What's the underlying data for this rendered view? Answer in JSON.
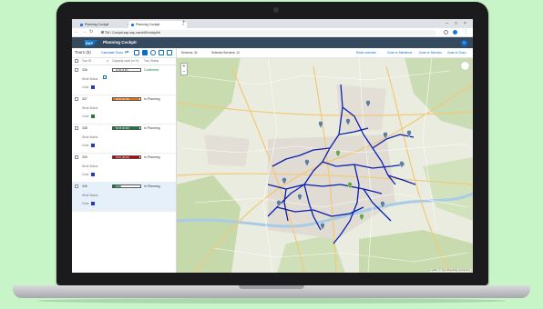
{
  "browser": {
    "tabs": [
      {
        "label": "Planning Cockpit"
      },
      {
        "label": "Planning Cockpit"
      }
    ],
    "url": "TM / Cockpit.sap.sap.com/ui5/cockpit/#"
  },
  "shell": {
    "logo": "SAP",
    "title": "Planning Cockpit",
    "avatar_initial": "U"
  },
  "left_panel": {
    "title": "Tours (5)",
    "action": "Calculate Tours",
    "columns": [
      "Tour ID",
      "Capacity used (in %)",
      "Tour Status"
    ],
    "field_labels": {
      "work_status": "Work Status",
      "color": "Color"
    },
    "tours": [
      {
        "id": "336",
        "capacity_label": "10.50 (2.50)",
        "capacity": 0.05,
        "fill_color": "#ffffff",
        "status": "Confirmed",
        "status_kind": "ok",
        "swatch": "#1f3fbf",
        "selected": false
      },
      {
        "id": "337",
        "capacity_label": "34.00 (17.00)",
        "capacity": 0.95,
        "fill_color": "#e9730c",
        "status": "In Planning",
        "status_kind": "plan",
        "swatch": "#2b7a2b",
        "selected": false
      },
      {
        "id": "338",
        "capacity_label": "58.35 (54.85)",
        "capacity": 0.95,
        "fill_color": "#107e3e",
        "status": "In Planning",
        "status_kind": "plan",
        "swatch": "#1f3fbf",
        "selected": false
      },
      {
        "id": "339",
        "capacity_label": "78.67 (39.33)",
        "capacity": 0.95,
        "fill_color": "#bb0000",
        "status": "In Planning",
        "status_kind": "plan",
        "swatch": "#1f3fbf",
        "selected": false
      },
      {
        "id": "340",
        "capacity_label": "33.00 (27.50)",
        "capacity": 0.3,
        "fill_color": "#107e3e",
        "status": "In Planning",
        "status_kind": "plan",
        "swatch": "#1f3fbf",
        "selected": true
      }
    ]
  },
  "map": {
    "counts": [
      {
        "label": "Services: 34"
      },
      {
        "label": "Selected Services: 12"
      }
    ],
    "actions": [
      {
        "label": "Reset overview"
      },
      {
        "label": "Zoom to Selections"
      },
      {
        "label": "Zoom to Services"
      },
      {
        "label": "Zoom to Tours"
      }
    ],
    "attribution": "Leaflet | © OpenStreetMap contributors",
    "route_color": "#0b1fb0"
  }
}
